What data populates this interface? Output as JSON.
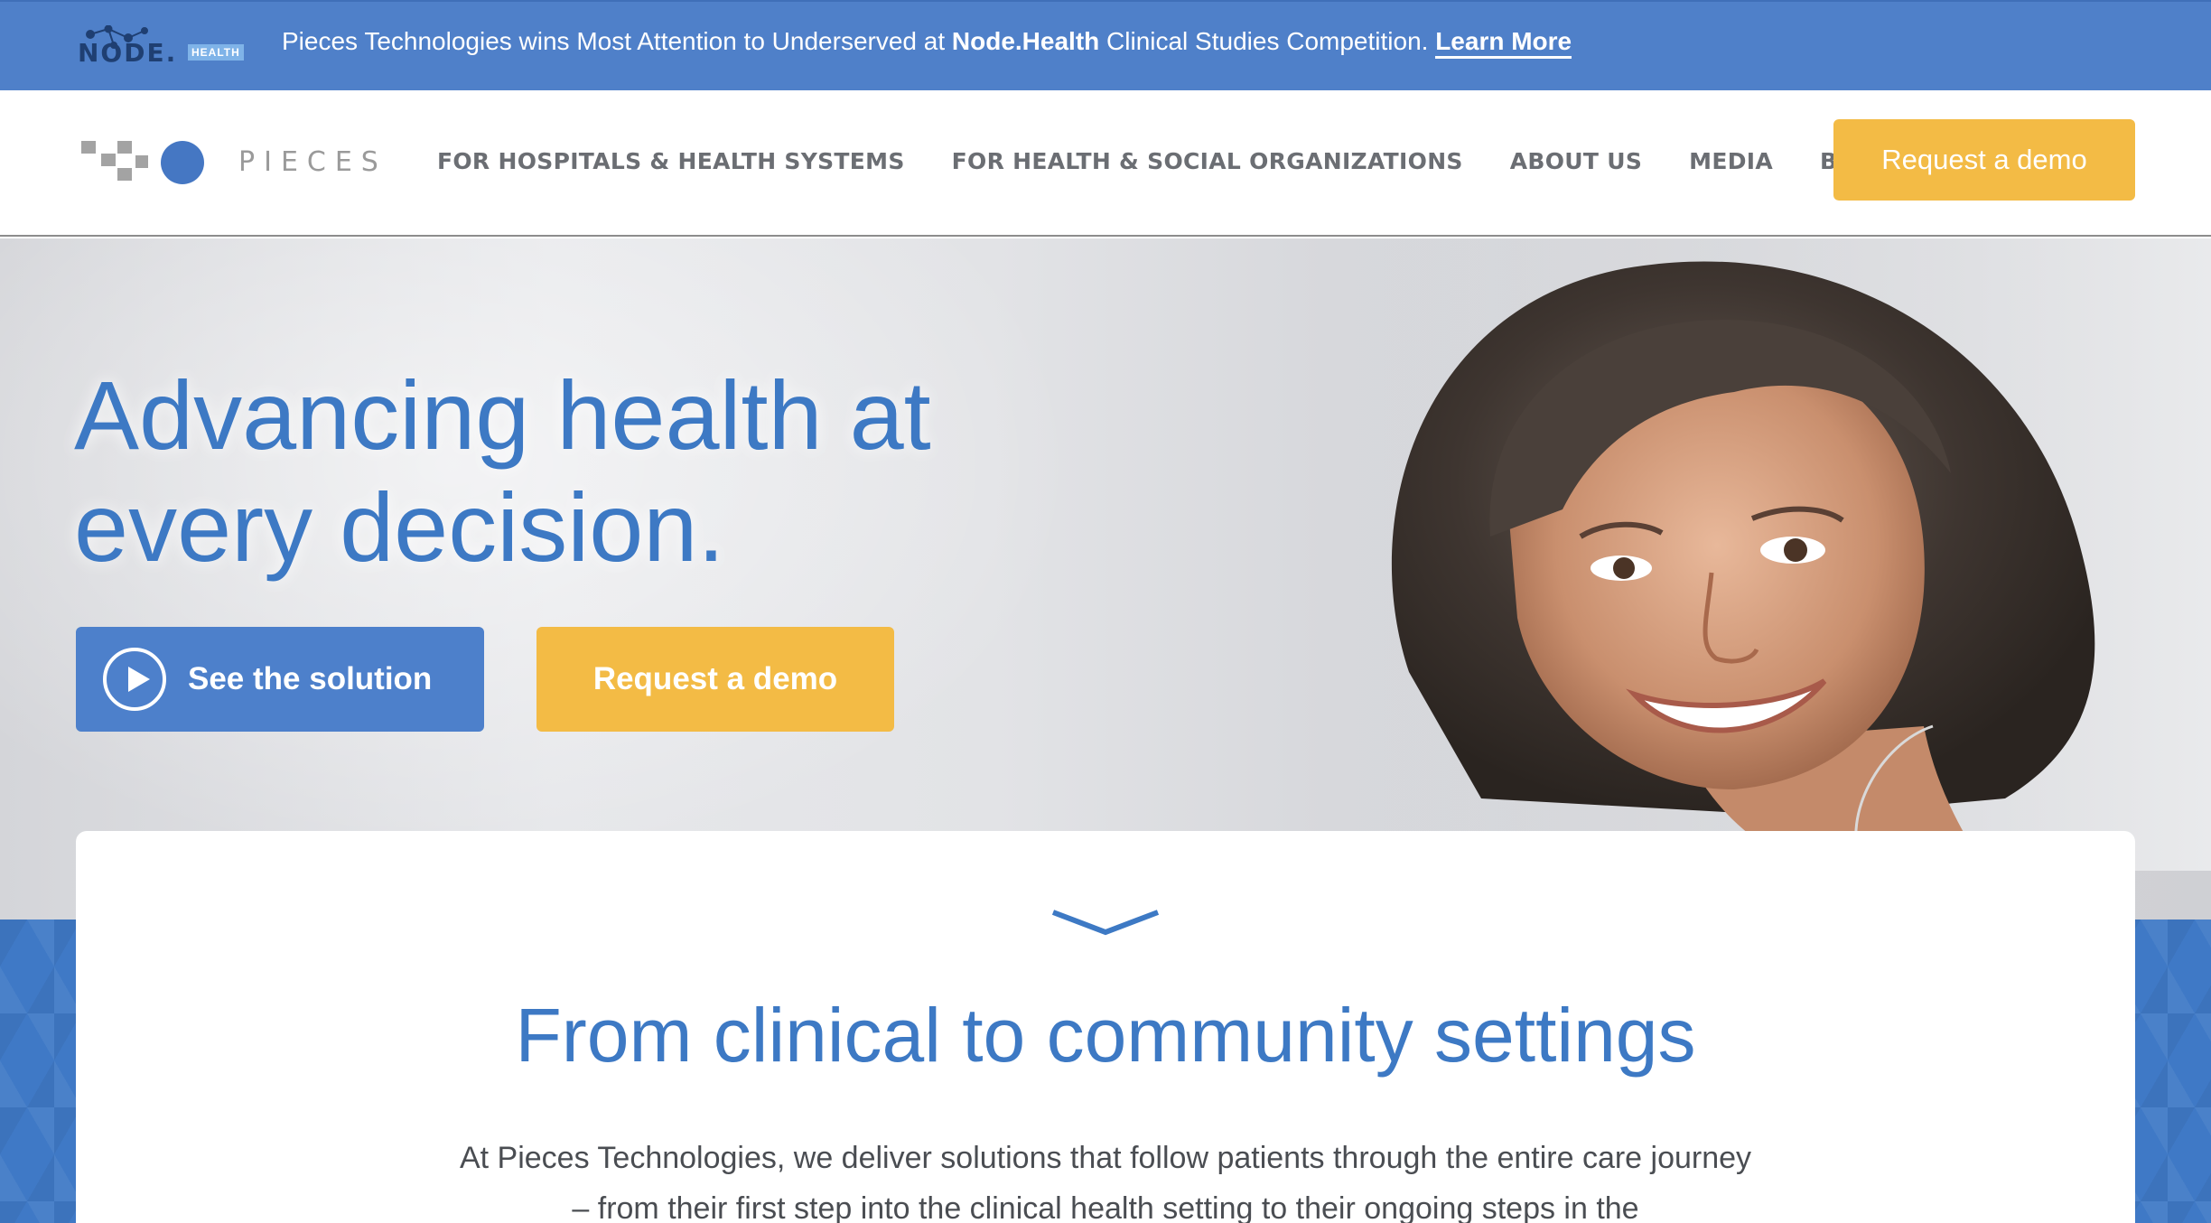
{
  "announcement": {
    "logo_text": "NODE.",
    "logo_badge": "HEALTH",
    "text_before": "Pieces Technologies wins Most Attention to Underserved at ",
    "text_bold": "Node.Health",
    "text_after": " Clinical Studies Competition. ",
    "link_label": "Learn More"
  },
  "nav": {
    "brand": "PIECES",
    "links": [
      "FOR HOSPITALS & HEALTH SYSTEMS",
      "FOR HEALTH & SOCIAL ORGANIZATIONS",
      "ABOUT US",
      "MEDIA",
      "BLOG"
    ],
    "cta_label": "Request a demo"
  },
  "hero": {
    "title": "Advancing health at every decision.",
    "primary_button": "See the solution",
    "secondary_button": "Request a demo"
  },
  "section": {
    "title": "From clinical to community settings",
    "body": "At Pieces Technologies, we deliver solutions that follow patients through the entire care journey – from their first step into the clinical health setting to their ongoing steps in the"
  },
  "colors": {
    "brand_blue": "#4f80c9",
    "heading_blue": "#3d79c4",
    "accent_yellow": "#f3bb45",
    "nav_text": "#6b6e73"
  }
}
